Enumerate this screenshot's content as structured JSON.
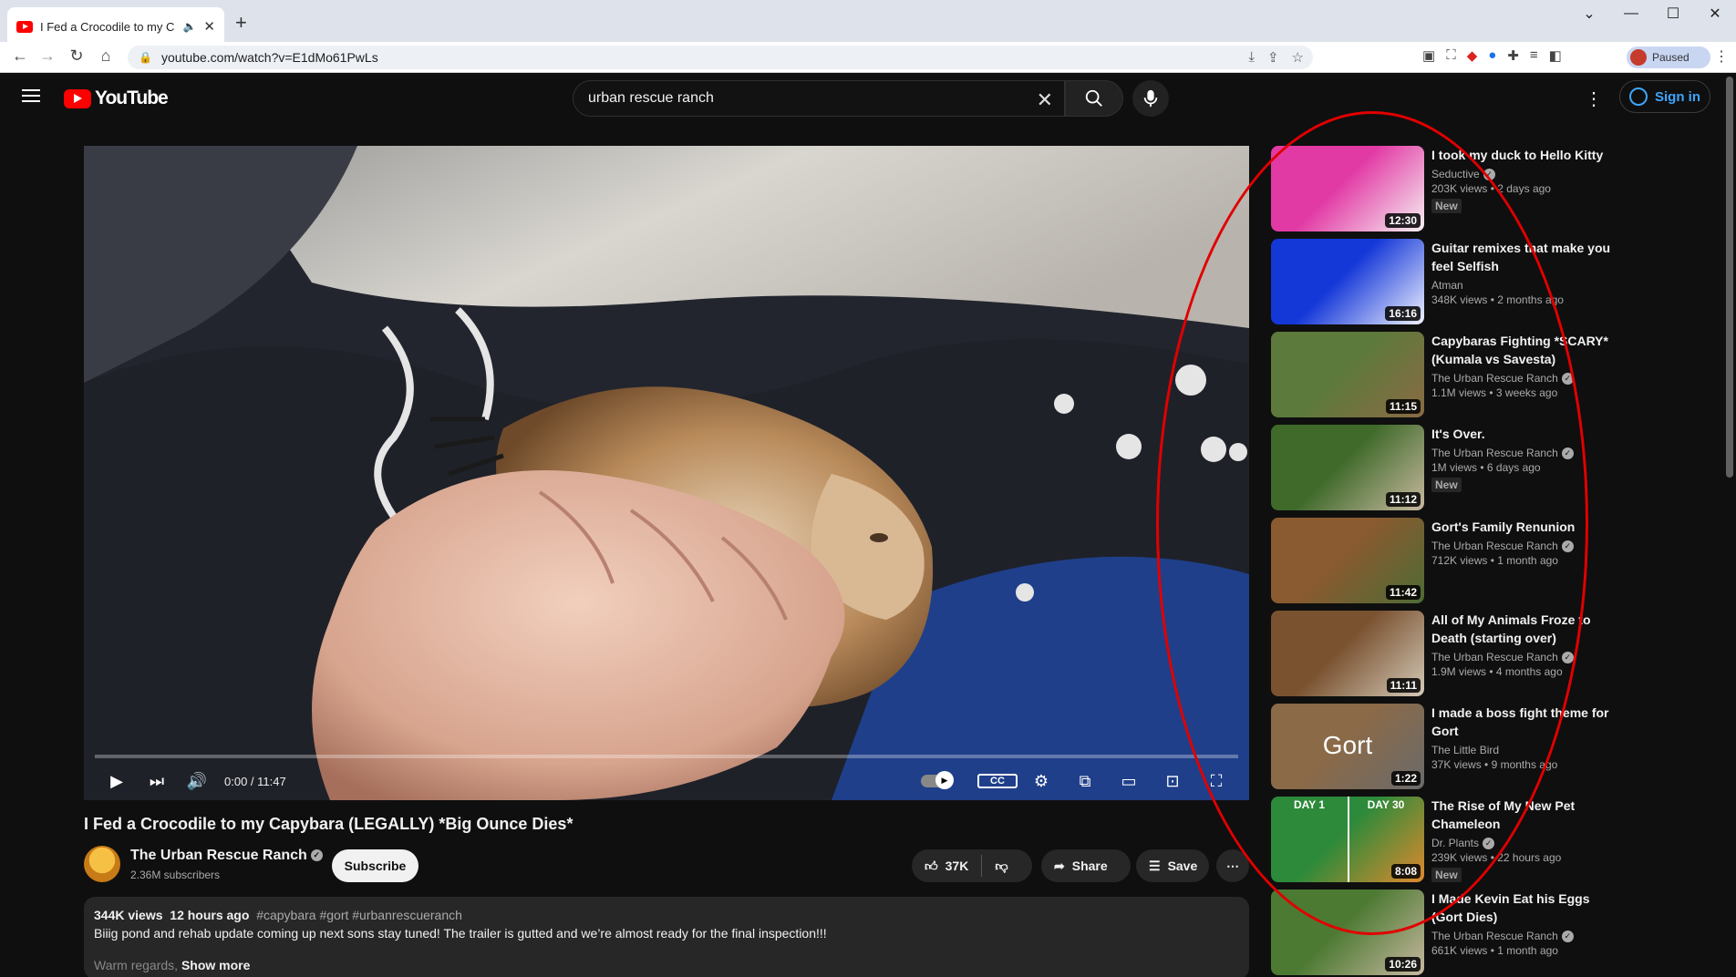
{
  "browser": {
    "tab_title": "I Fed a Crocodile to my Capy",
    "url": "youtube.com/watch?v=E1dMo61PwLs",
    "profile_label": "Paused"
  },
  "header": {
    "logo_text": "YouTube",
    "search_value": "urban rescue ranch",
    "signin_label": "Sign in"
  },
  "player": {
    "time": "0:00 / 11:47",
    "progress": 0
  },
  "video": {
    "title": "I Fed a Crocodile to my Capybara (LEGALLY) *Big Ounce Dies*",
    "channel": "The Urban Rescue Ranch",
    "subscribers": "2.36M subscribers",
    "subscribe_label": "Subscribe",
    "likes": "37K",
    "share_label": "Share",
    "save_label": "Save",
    "description": {
      "views": "344K views",
      "age": "12 hours ago",
      "tags": "#capybara #gort #urbanrescueranch",
      "line1": "Biiig pond and rehab update coming up next sons stay tuned! The trailer is gutted and we’re almost ready for the final inspection!!!",
      "line2": "Warm regards,",
      "show_more": "Show more"
    }
  },
  "recommendations": [
    {
      "title": "I took my duck to Hello Kitty",
      "channel": "Seductive",
      "verified": true,
      "views": "203K views",
      "age": "2 days ago",
      "new": true,
      "duration": "12:30",
      "thumb": [
        "#e23aa5",
        "#f6f2f2"
      ]
    },
    {
      "title": "Guitar remixes that make you feel Selfish",
      "channel": "Atman",
      "verified": false,
      "views": "348K views",
      "age": "2 months ago",
      "new": false,
      "duration": "16:16",
      "thumb": [
        "#1437d8",
        "#f0f2ff"
      ]
    },
    {
      "title": "Capybaras Fighting *SCARY* (Kumala vs Savesta)",
      "channel": "The Urban Rescue Ranch",
      "verified": true,
      "views": "1.1M views",
      "age": "3 weeks ago",
      "new": false,
      "duration": "11:15",
      "thumb": [
        "#5c7a3b",
        "#8a6a44"
      ]
    },
    {
      "title": "It's Over.",
      "channel": "The Urban Rescue Ranch",
      "verified": true,
      "views": "1M views",
      "age": "6 days ago",
      "new": true,
      "duration": "11:12",
      "thumb": [
        "#3f6a2a",
        "#c8b9a0"
      ]
    },
    {
      "title": "Gort's Family Renunion",
      "channel": "The Urban Rescue Ranch",
      "verified": true,
      "views": "712K views",
      "age": "1 month ago",
      "new": false,
      "duration": "11:42",
      "thumb": [
        "#8a5a30",
        "#4d6b35"
      ]
    },
    {
      "title": "All of My Animals Froze to Death (starting over)",
      "channel": "The Urban Rescue Ranch",
      "verified": true,
      "views": "1.9M views",
      "age": "4 months ago",
      "new": false,
      "duration": "11:11",
      "thumb": [
        "#7a5230",
        "#d4c9b8"
      ]
    },
    {
      "title": "I made a boss fight theme for Gort",
      "channel": "The Little Bird",
      "verified": false,
      "views": "37K views",
      "age": "9 months ago",
      "new": false,
      "duration": "1:22",
      "thumb": [
        "#8b6a48",
        "#6a6a6a"
      ],
      "overlay": "Gort"
    },
    {
      "title": "The Rise of My New Pet Chameleon",
      "channel": "Dr. Plants",
      "verified": true,
      "views": "239K views",
      "age": "22 hours ago",
      "new": true,
      "duration": "8:08",
      "thumb": [
        "#2c8a3a",
        "#e0892e"
      ],
      "overlay_left": "DAY 1",
      "overlay_right": "DAY 30"
    },
    {
      "title": "I Made Kevin Eat his Eggs (Gort Dies)",
      "channel": "The Urban Rescue Ranch",
      "verified": true,
      "views": "661K views",
      "age": "1 month ago",
      "new": false,
      "duration": "10:26",
      "thumb": [
        "#4d7a33",
        "#c8b8a0"
      ]
    }
  ],
  "colors": {
    "background": "#0f0f0f",
    "accent": "#ff0000",
    "link": "#3ea6ff",
    "annotation": "#e00000"
  }
}
